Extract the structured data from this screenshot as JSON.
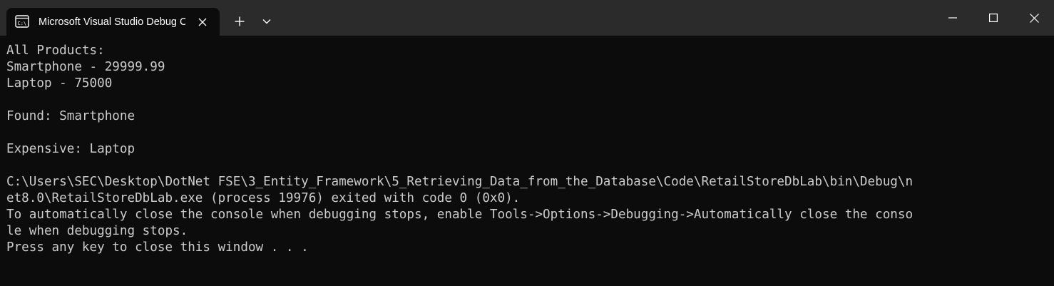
{
  "window": {
    "tab_title": "Microsoft Visual Studio Debug Console",
    "tab_icon": "console-icon",
    "close_tab_icon": "close-icon",
    "new_tab_icon": "plus-icon",
    "dropdown_icon": "chevron-down-icon",
    "minimize_icon": "minimize-icon",
    "maximize_icon": "maximize-icon",
    "close_window_icon": "close-icon"
  },
  "colors": {
    "titlebar_bg": "#2b2b2b",
    "console_bg": "#0c0c0c",
    "console_text": "#cccccc",
    "title_text": "#ffffff"
  },
  "console": {
    "lines": [
      "All Products:",
      "Smartphone - 29999.99",
      "Laptop - 75000",
      "",
      "Found: Smartphone",
      "",
      "Expensive: Laptop",
      "",
      "C:\\Users\\SEC\\Desktop\\DotNet FSE\\3_Entity_Framework\\5_Retrieving_Data_from_the_Database\\Code\\RetailStoreDbLab\\bin\\Debug\\n",
      "et8.0\\RetailStoreDbLab.exe (process 19976) exited with code 0 (0x0).",
      "To automatically close the console when debugging stops, enable Tools->Options->Debugging->Automatically close the conso",
      "le when debugging stops.",
      "Press any key to close this window . . ."
    ]
  }
}
